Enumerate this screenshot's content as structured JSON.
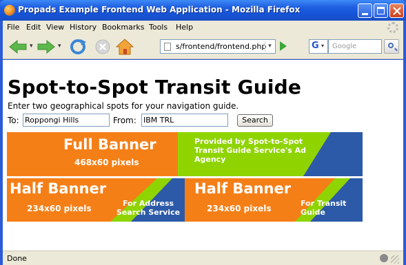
{
  "window": {
    "title": "Propads Example Frontend Web Application - Mozilla Firefox"
  },
  "menubar": {
    "items": [
      "File",
      "Edit",
      "View",
      "History",
      "Bookmarks",
      "Tools",
      "Help"
    ]
  },
  "toolbar": {
    "url": "s/frontend/frontend.php",
    "search_engine": "G",
    "search_placeholder": "Google"
  },
  "page": {
    "title": "Spot-to-Spot Transit Guide",
    "description": "Enter two geographical spots for your navigation guide.",
    "form": {
      "to_label": "To:",
      "to_value": "Roppongi Hills",
      "from_label": "From:",
      "from_value": "IBM TRL",
      "submit_label": "Search"
    },
    "banners": {
      "full": {
        "title": "Full Banner",
        "size": "468x60 pixels",
        "ad_text": "Provided by Spot-to-Spot Transit Guide Service's Ad Agency"
      },
      "half_left": {
        "title": "Half Banner",
        "size": "234x60 pixels",
        "ad_text": "For Address Search Service"
      },
      "half_right": {
        "title": "Half Banner",
        "size": "234x60 pixels",
        "ad_text": "For Transit Guide"
      }
    }
  },
  "statusbar": {
    "text": "Done"
  },
  "colors": {
    "banner_orange": "#f57f17",
    "banner_green": "#8fd400",
    "banner_blue": "#2c5aa8",
    "title_bar_blue": "#1553d6"
  }
}
